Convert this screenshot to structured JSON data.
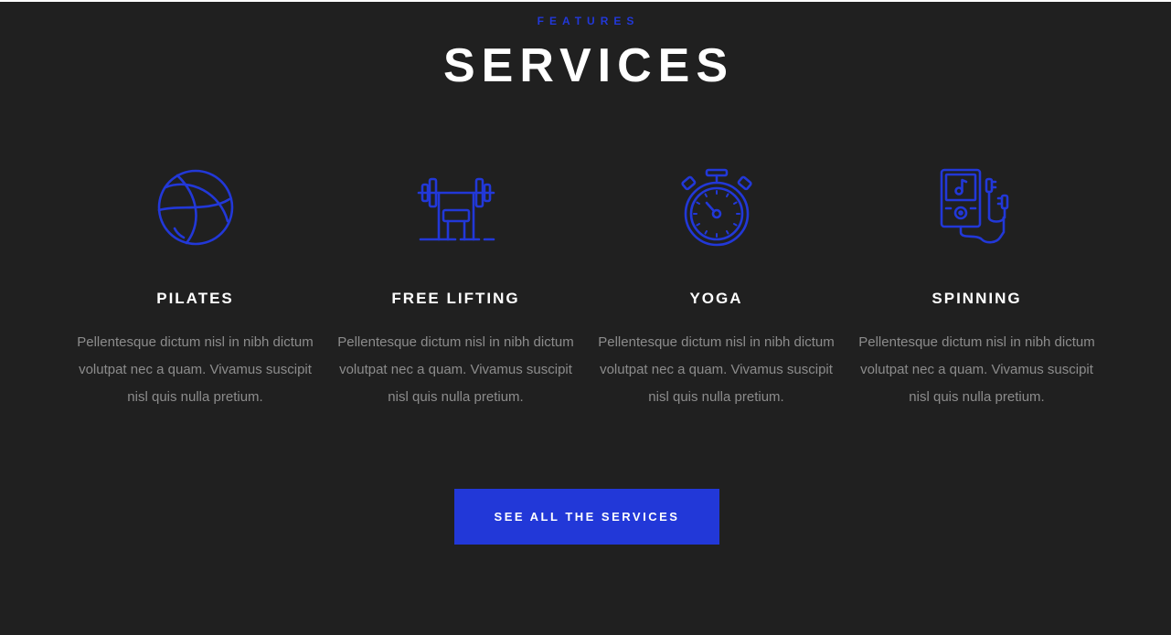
{
  "section": {
    "eyebrow": "FEATURES",
    "title": "SERVICES",
    "accent_color": "#2238d8",
    "background_color": "#202020"
  },
  "services": [
    {
      "name": "PILATES",
      "icon": "basketball-icon",
      "description": "Pellentesque dictum nisl in nibh dictum volutpat nec a quam. Vivamus suscipit nisl quis nulla pretium."
    },
    {
      "name": "FREE LIFTING",
      "icon": "weight-bench-icon",
      "description": "Pellentesque dictum nisl in nibh dictum volutpat nec a quam. Vivamus suscipit nisl quis nulla pretium."
    },
    {
      "name": "YOGA",
      "icon": "stopwatch-icon",
      "description": "Pellentesque dictum nisl in nibh dictum volutpat nec a quam. Vivamus suscipit nisl quis nulla pretium."
    },
    {
      "name": "SPINNING",
      "icon": "music-player-icon",
      "description": "Pellentesque dictum nisl in nibh dictum volutpat nec a quam. Vivamus suscipit nisl quis nulla pretium."
    }
  ],
  "cta": {
    "label": "SEE ALL THE SERVICES"
  }
}
